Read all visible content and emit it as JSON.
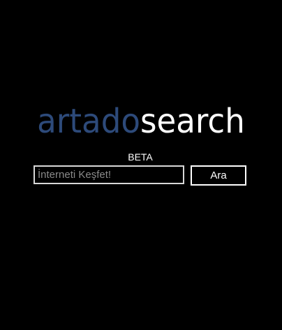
{
  "logo": {
    "part1": "artado",
    "part2": "search"
  },
  "beta_label": "BETA",
  "search": {
    "placeholder": "İnterneti Keşfet!",
    "value": "",
    "button_label": "Ara"
  },
  "colors": {
    "background": "#000000",
    "logo_accent": "#2d4a7a",
    "text": "#ffffff",
    "input_border": "#d8d8d8"
  }
}
